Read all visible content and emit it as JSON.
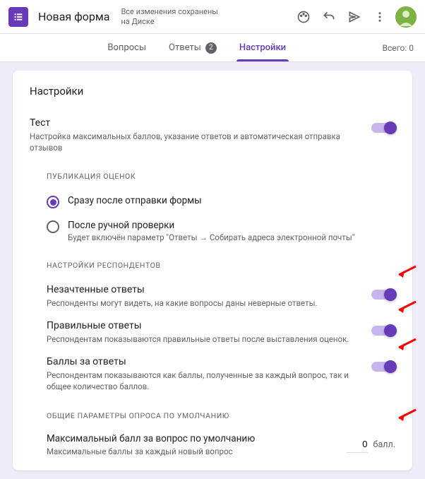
{
  "header": {
    "title": "Новая форма",
    "save_status": "Все изменения сохранены\nна Диске"
  },
  "tabs": {
    "questions": "Вопросы",
    "responses": "Ответы",
    "responses_count": "2",
    "settings": "Настройки",
    "total": "Всего: 0"
  },
  "card": {
    "title": "Настройки",
    "quiz": {
      "title": "Тест",
      "desc": "Настройка максимальных баллов, указание ответов и автоматическая отправка отзывов"
    },
    "pub_label": "ПУБЛИКАЦИЯ ОЦЕНОК",
    "radio1": {
      "label": "Сразу после отправки формы"
    },
    "radio2": {
      "label": "После ручной проверки",
      "desc": "Будет включён параметр \"Ответы → Собирать адреса электронной почты\""
    },
    "resp_label": "НАСТРОЙКИ РЕСПОНДЕНТОВ",
    "opt1": {
      "title": "Незачтенные ответы",
      "desc": "Респонденты могут видеть, на какие вопросы даны неверные ответы."
    },
    "opt2": {
      "title": "Правильные ответы",
      "desc": "Респондентам показываются правильные ответы после выставления оценок."
    },
    "opt3": {
      "title": "Баллы за ответы",
      "desc": "Респондентам показываются как баллы, полученные за каждый вопрос, так и общее количество баллов."
    },
    "defaults_label": "ОБЩИЕ ПАРАМЕТРЫ ОПРОСА ПО УМОЛЧАНИЮ",
    "max": {
      "title": "Максимальный балл за вопрос по умолчанию",
      "desc": "Максимальные баллы за каждый новый вопрос",
      "value": "0",
      "unit": "балл."
    }
  }
}
